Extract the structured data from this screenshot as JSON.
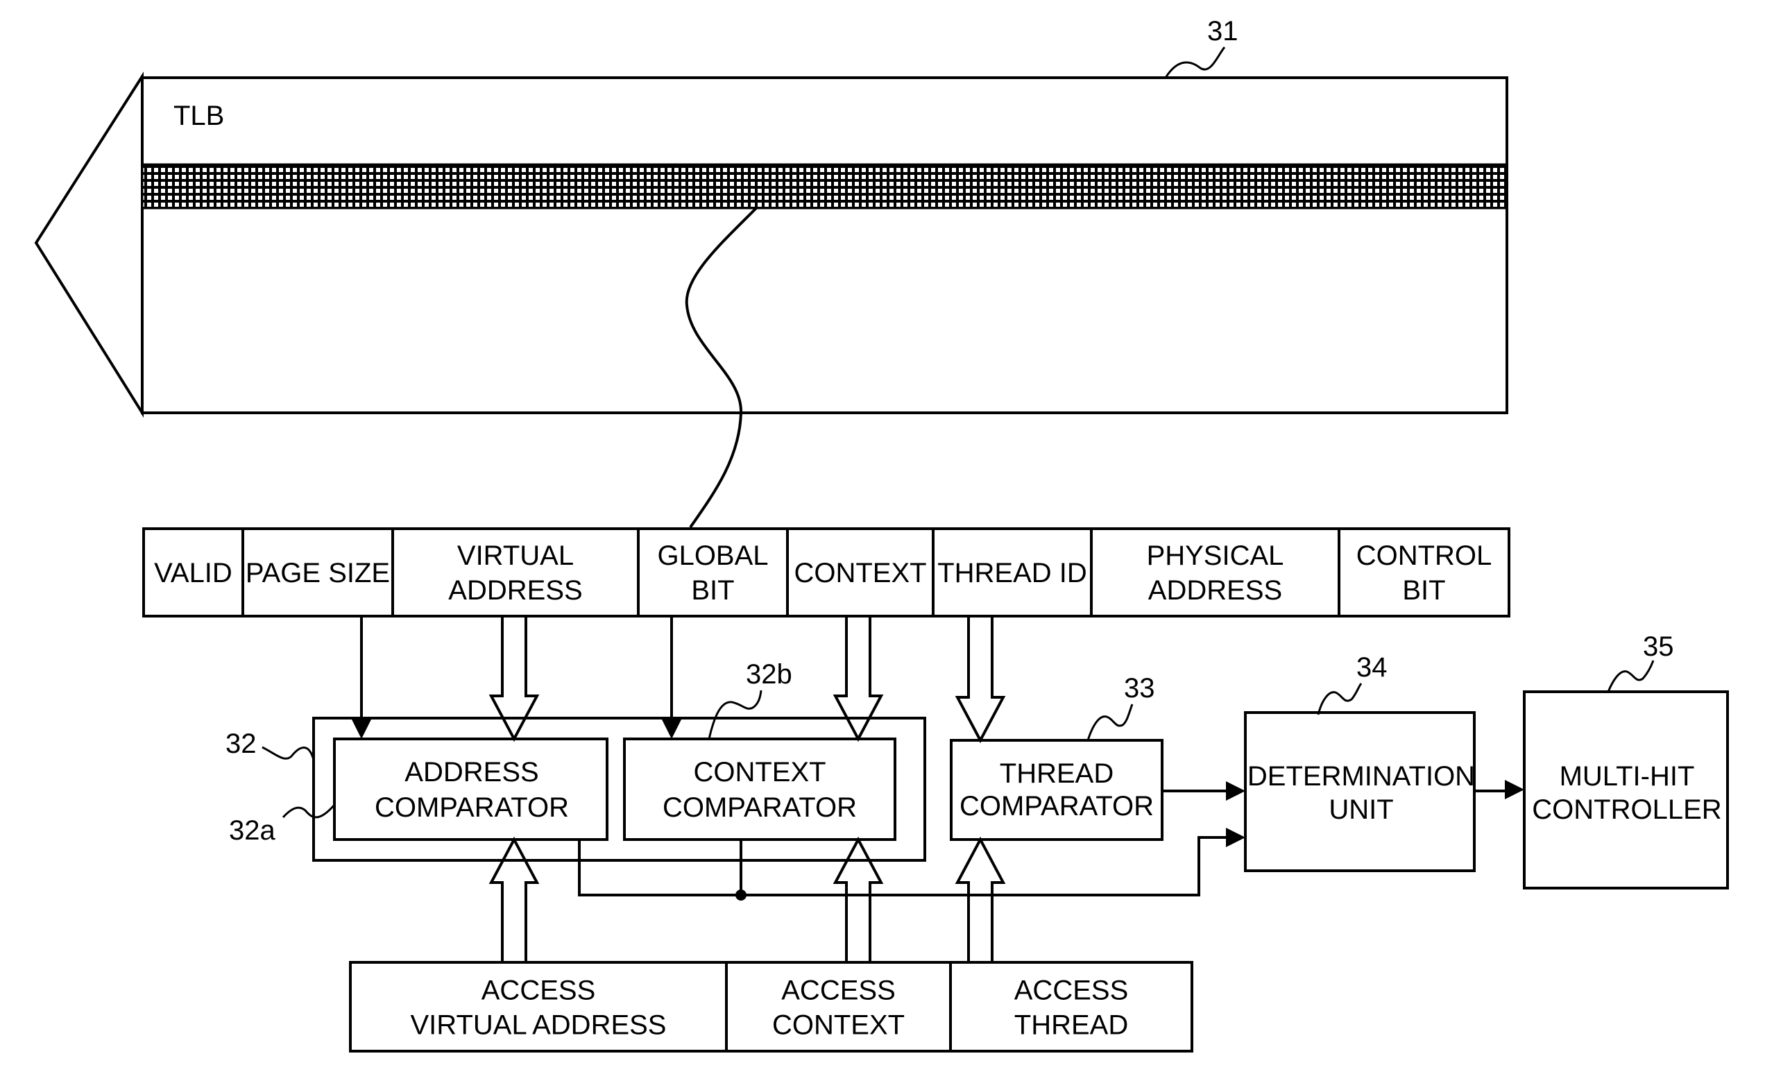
{
  "figure": {
    "tlb": {
      "title": "TLB",
      "ref": "31"
    },
    "entry_fields": [
      {
        "id": "valid",
        "lines": [
          "VALID"
        ]
      },
      {
        "id": "page-size",
        "lines": [
          "PAGE SIZE"
        ]
      },
      {
        "id": "virtual-address",
        "lines": [
          "VIRTUAL",
          "ADDRESS"
        ]
      },
      {
        "id": "global-bit",
        "lines": [
          "GLOBAL",
          "BIT"
        ]
      },
      {
        "id": "context",
        "lines": [
          "CONTEXT"
        ]
      },
      {
        "id": "thread-id",
        "lines": [
          "THREAD ID"
        ]
      },
      {
        "id": "physical-address",
        "lines": [
          "PHYSICAL",
          "ADDRESS"
        ]
      },
      {
        "id": "control-bit",
        "lines": [
          "CONTROL",
          "BIT"
        ]
      }
    ],
    "comparator_group": {
      "ref": "32"
    },
    "address_comparator": {
      "ref": "32a",
      "lines": [
        "ADDRESS",
        "COMPARATOR"
      ]
    },
    "context_comparator": {
      "ref": "32b",
      "lines": [
        "CONTEXT",
        "COMPARATOR"
      ]
    },
    "thread_comparator": {
      "ref": "33",
      "lines": [
        "THREAD",
        "COMPARATOR"
      ]
    },
    "determination_unit": {
      "ref": "34",
      "lines": [
        "DETERMINATION",
        "UNIT"
      ]
    },
    "multi_hit_controller": {
      "ref": "35",
      "lines": [
        "MULTI-HIT",
        "CONTROLLER"
      ]
    },
    "access_inputs": [
      {
        "id": "access-virtual-address",
        "lines": [
          "ACCESS",
          "VIRTUAL ADDRESS"
        ]
      },
      {
        "id": "access-context",
        "lines": [
          "ACCESS",
          "CONTEXT"
        ]
      },
      {
        "id": "access-thread",
        "lines": [
          "ACCESS",
          "THREAD"
        ]
      }
    ]
  }
}
